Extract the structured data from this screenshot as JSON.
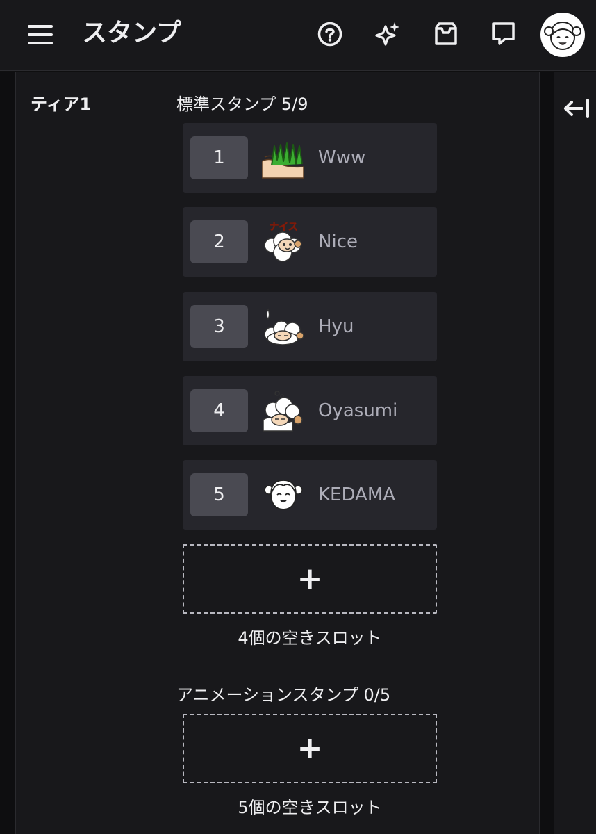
{
  "header": {
    "title": "スタンプ",
    "icons": [
      "menu-icon",
      "help-icon",
      "sparkle-icon",
      "inbox-icon",
      "whisper-icon"
    ]
  },
  "tier": {
    "label": "ティア1"
  },
  "standard": {
    "title": "標準スタンプ 5/9",
    "slots": [
      {
        "num": "1",
        "name": "Www"
      },
      {
        "num": "2",
        "name": "Nice"
      },
      {
        "num": "3",
        "name": "Hyu"
      },
      {
        "num": "4",
        "name": "Oyasumi"
      },
      {
        "num": "5",
        "name": "KEDAMA"
      }
    ],
    "add_label": "+",
    "empty_note": "4個の空きスロット"
  },
  "animated": {
    "title": "アニメーションスタンプ 0/5",
    "add_label": "+",
    "empty_note": "5個の空きスロット"
  },
  "sidebar": {
    "collapse_icon": "collapse-left-icon"
  },
  "colors": {
    "background": "#0f0f10",
    "panel": "#18181b",
    "slot": "#26262c",
    "slot_number": "#4a4a52"
  },
  "stamp_text": {
    "nice": "ナイス"
  }
}
